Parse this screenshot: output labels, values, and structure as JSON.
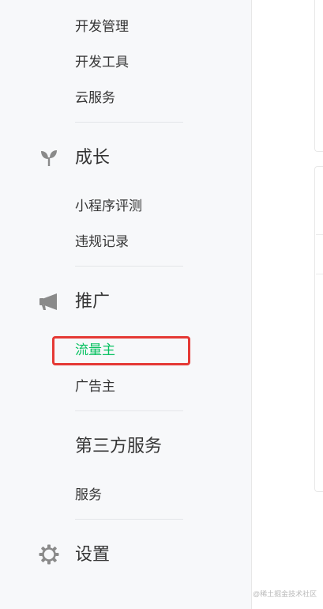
{
  "sidebar": {
    "dev_items": [
      "开发管理",
      "开发工具",
      "云服务"
    ],
    "groups": {
      "growth": {
        "title": "成长",
        "icon": "sprout-icon",
        "items": [
          "小程序评测",
          "违规记录"
        ]
      },
      "promotion": {
        "title": "推广",
        "icon": "megaphone-icon",
        "items": [
          "流量主",
          "广告主"
        ],
        "active_item": "流量主"
      },
      "third_party": {
        "title": "第三方服务",
        "items": [
          "服务"
        ]
      },
      "settings": {
        "title": "设置",
        "icon": "gear-icon"
      }
    }
  },
  "annotation": {
    "highlight_color": "#e53935",
    "highlighted_item": "流量主"
  },
  "colors": {
    "active": "#07c160",
    "text": "#353535",
    "sidebar_bg": "#f7f8fa"
  },
  "watermark": "@稀土掘金技术社区"
}
